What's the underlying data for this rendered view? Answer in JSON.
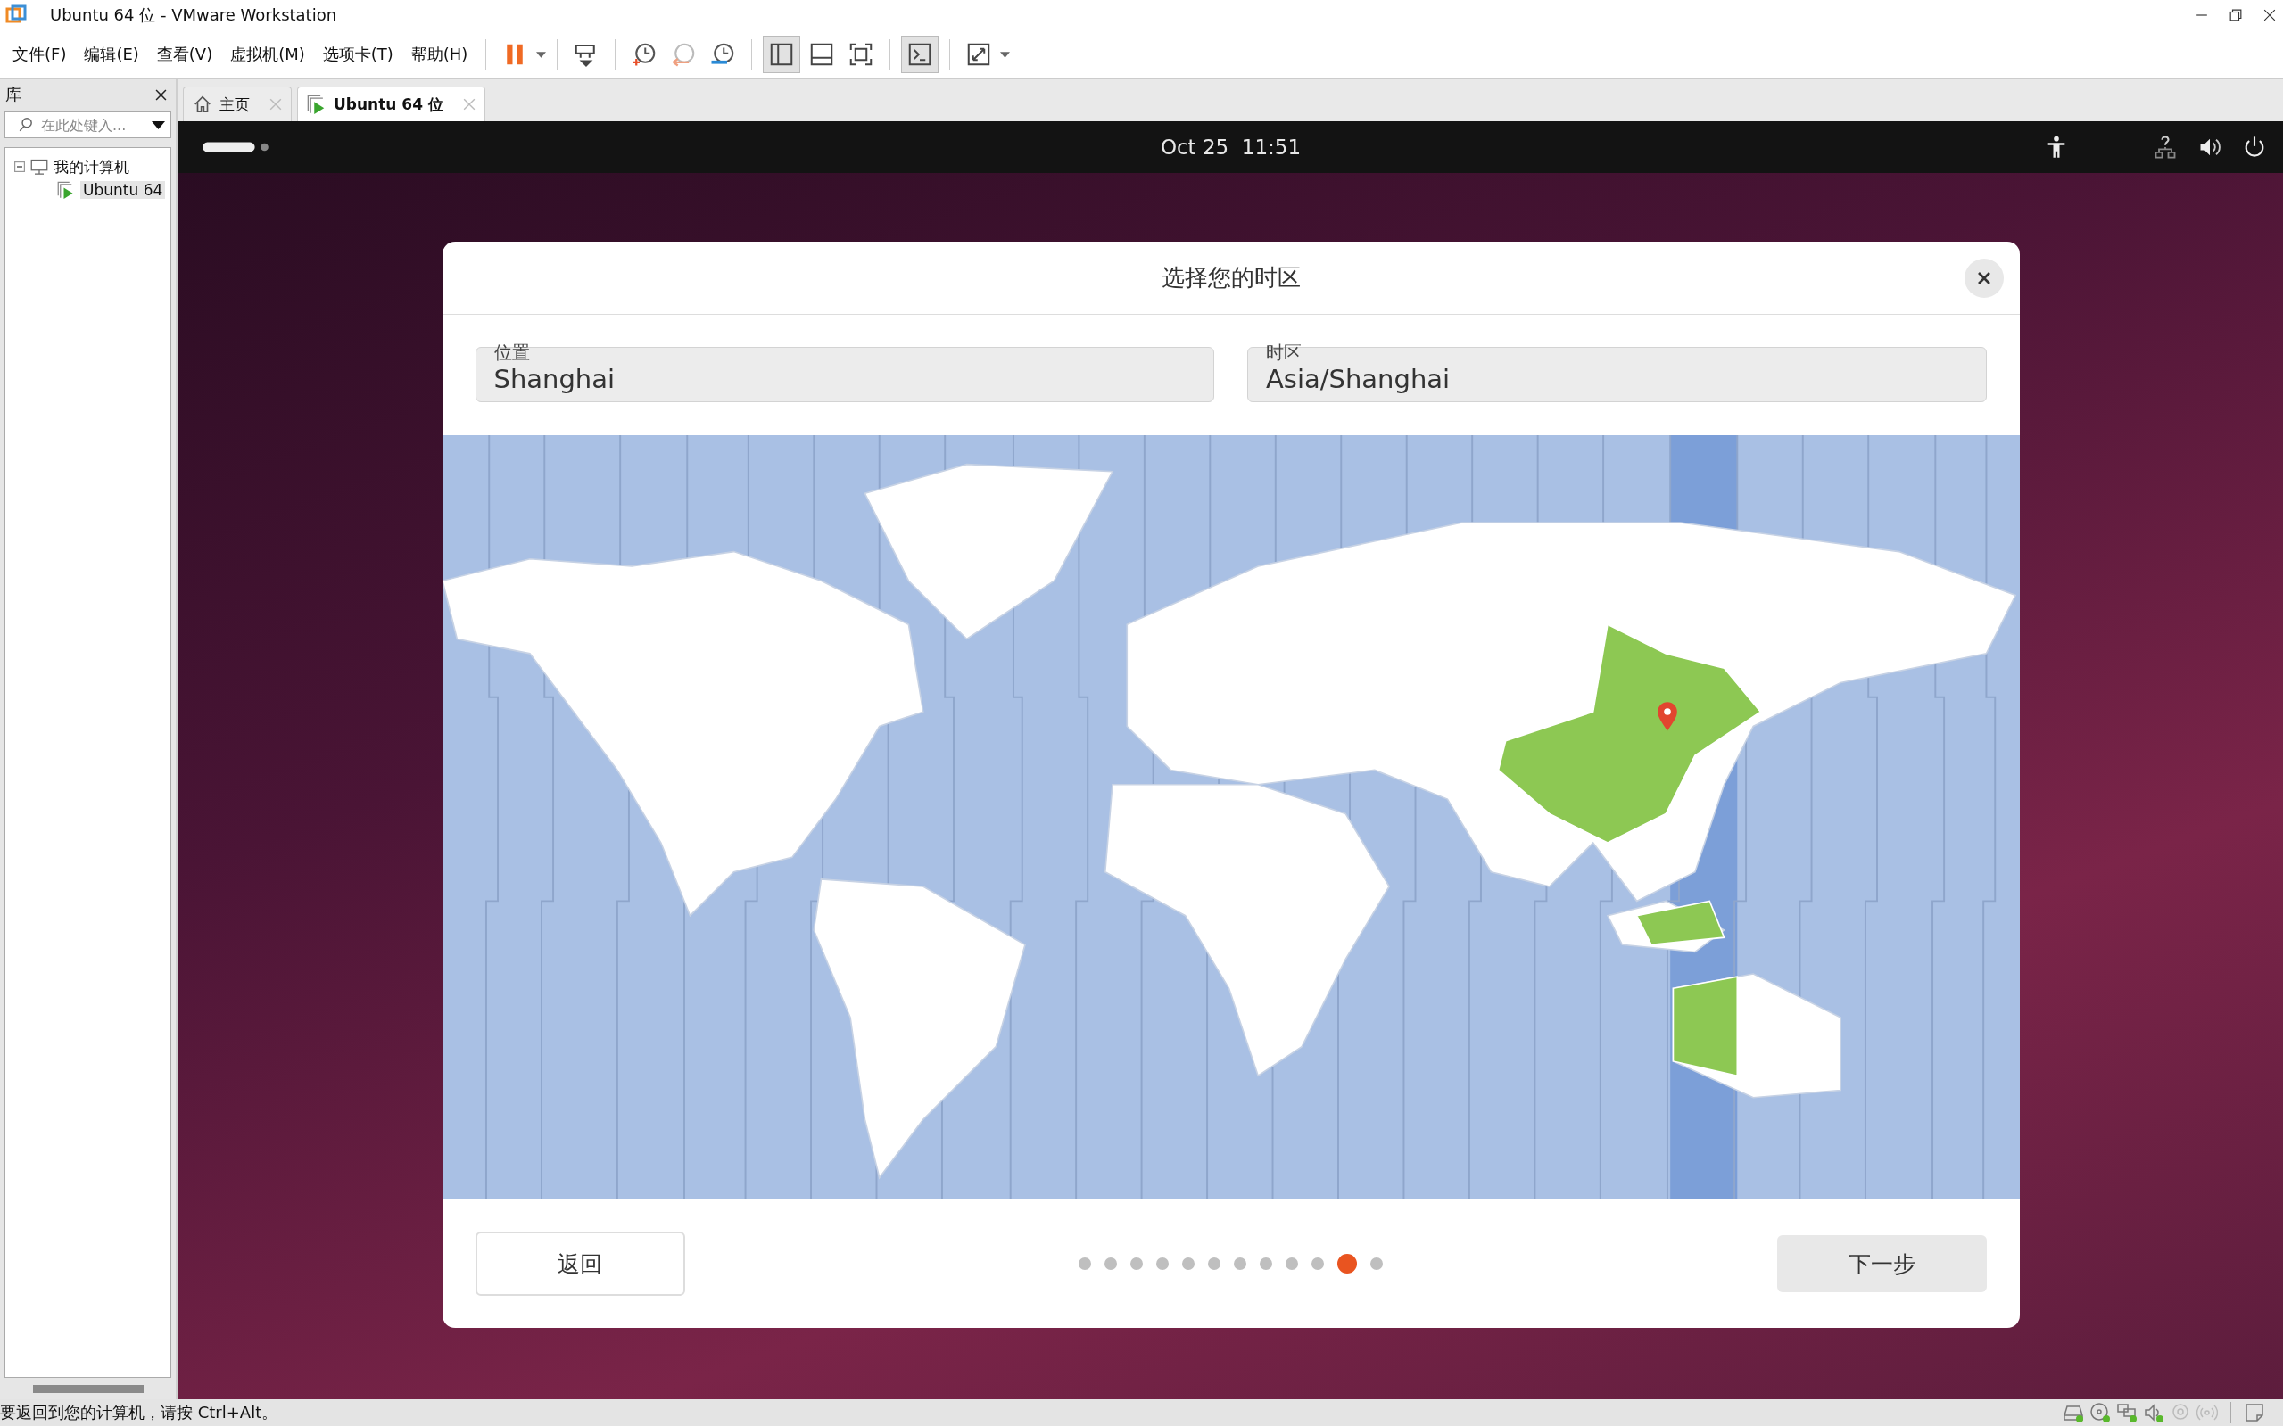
{
  "window": {
    "title": "Ubuntu 64 位 - VMware Workstation"
  },
  "menu": [
    "文件(F)",
    "编辑(E)",
    "查看(V)",
    "虚拟机(M)",
    "选项卡(T)",
    "帮助(H)"
  ],
  "library": {
    "title": "库",
    "search": {
      "placeholder": "在此处键入..."
    },
    "tree": [
      {
        "label": "我的计算机",
        "expanded": true,
        "children": [
          {
            "label": "Ubuntu 64",
            "selected": true
          }
        ]
      }
    ]
  },
  "tabs": [
    {
      "label": "主页",
      "selected": false
    },
    {
      "label": "Ubuntu 64 位",
      "selected": true
    }
  ],
  "guest": {
    "clock": "Oct 25  11:51",
    "dialog": {
      "title": "选择您的时区",
      "fields": [
        {
          "label": "位置",
          "value": "Shanghai"
        },
        {
          "label": "时区",
          "value": "Asia/Shanghai"
        }
      ],
      "back": "返回",
      "next": "下一步",
      "steps": [
        {
          "selected": false
        },
        {
          "selected": false
        },
        {
          "selected": false
        },
        {
          "selected": false
        },
        {
          "selected": false
        },
        {
          "selected": false
        },
        {
          "selected": false
        },
        {
          "selected": false
        },
        {
          "selected": false
        },
        {
          "selected": false
        },
        {
          "selected": true
        },
        {
          "selected": false
        }
      ]
    }
  },
  "status_bar": {
    "text": "要返回到您的计算机，请按 Ctrl+Alt。"
  }
}
